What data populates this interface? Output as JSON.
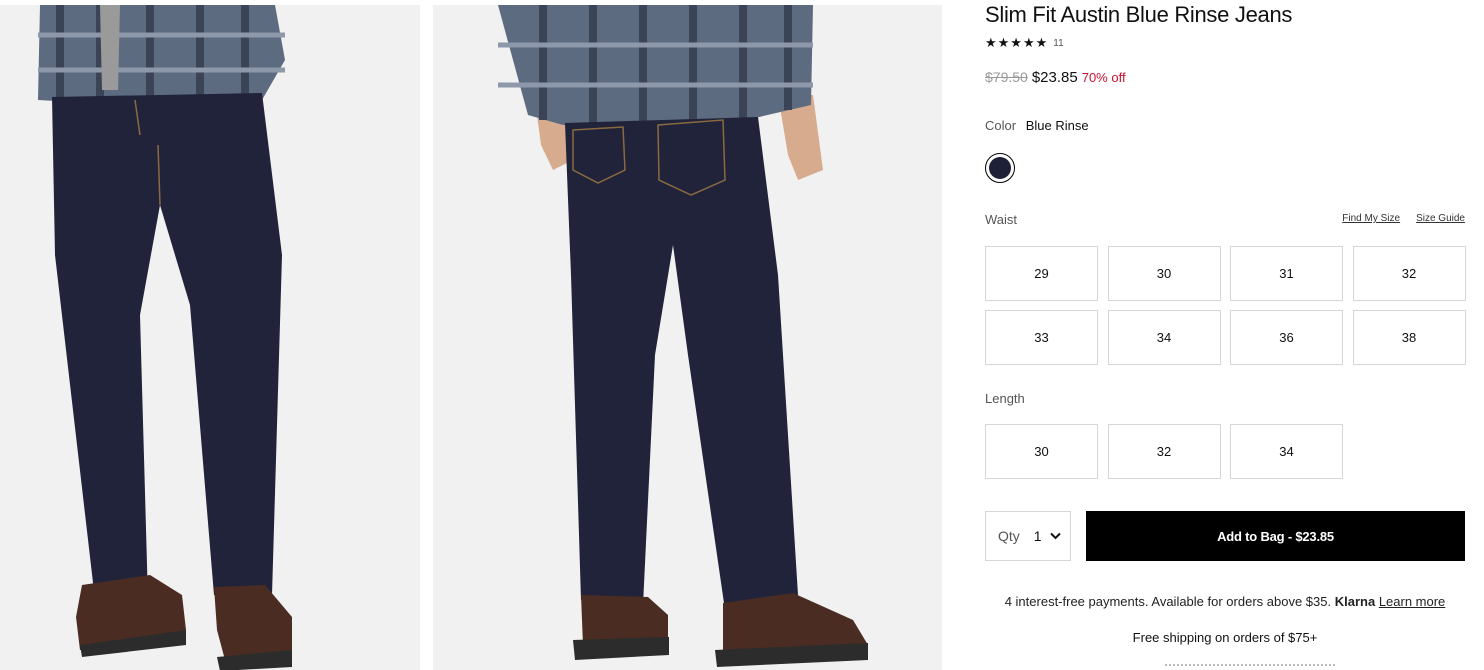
{
  "product": {
    "title": "Slim Fit Austin Blue Rinse Jeans",
    "stars": "★★★★★",
    "rating_count": "11",
    "price_original": "$79.50",
    "price_sale": "$23.85",
    "discount": "70% off"
  },
  "color": {
    "label": "Color",
    "value": "Blue Rinse",
    "swatch_hex": "#1d2036"
  },
  "waist": {
    "label": "Waist",
    "find_my_size": "Find My Size",
    "size_guide": "Size Guide",
    "options": [
      "29",
      "30",
      "31",
      "32",
      "33",
      "34",
      "36",
      "38"
    ]
  },
  "length": {
    "label": "Length",
    "options": [
      "30",
      "32",
      "34"
    ]
  },
  "purchase": {
    "qty_label": "Qty",
    "qty_value": "1",
    "add_to_bag": "Add to Bag  -  $23.85"
  },
  "klarna": {
    "text": "4 interest-free payments. Available for orders above $35.",
    "brand": "Klarna",
    "link": "Learn more"
  },
  "shipping": "Free shipping on orders of $75+",
  "icons": {
    "qty_chevron": "chevron-down-icon",
    "stars": "star-icon"
  },
  "colors": {
    "sale_red": "#c8102e",
    "button_bg": "#000000",
    "denim": "#1d2036"
  }
}
